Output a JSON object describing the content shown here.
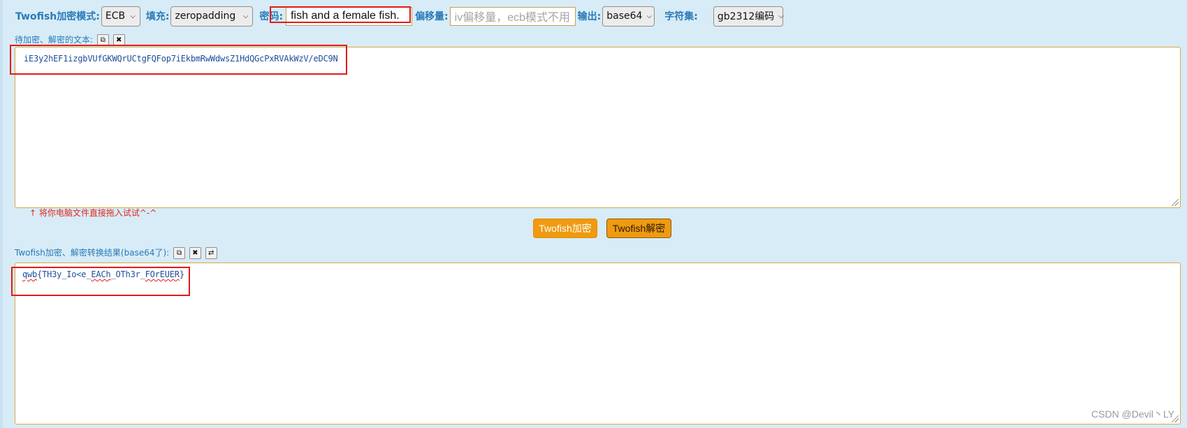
{
  "toolbar": {
    "mode_label": "Twofish加密模式:",
    "mode_value": "ECB",
    "padding_label": "填充:",
    "padding_value": "zeropadding",
    "password_label": "密码:",
    "password_value": "fish and a female fish.",
    "iv_label": "偏移量:",
    "iv_placeholder": "iv偏移量，ecb模式不用",
    "output_label": "输出:",
    "output_value": "base64",
    "charset_label": "字符集:",
    "charset_value": "gb2312编码"
  },
  "input_section": {
    "label": "待加密、解密的文本:",
    "copy_icon": "copy-icon",
    "clear_icon": "close-icon",
    "text": "iE3y2hEF1izgbVUfGKWQrUCtgFQFop7iEkbmRwWdwsZ1HdQGcPxRVAkWzV/eDC9N",
    "hint": "↑ 将你电脑文件直接拖入试试^-^"
  },
  "buttons": {
    "encrypt": "Twofish加密",
    "decrypt": "Twofish解密"
  },
  "result_section": {
    "label": "Twofish加密、解密转换结果(base64了):",
    "copy_icon": "copy-icon",
    "clear_icon": "close-icon",
    "swap_icon": "swap-icon",
    "text_parts": [
      "qwb",
      "{TH3y_Io<e_",
      "EACh",
      "_OTh3r_",
      "FOrEUER",
      "}"
    ]
  },
  "watermark": "CSDN @Devil丶LY",
  "colors": {
    "accent": "#ef9a10",
    "label_blue": "#2a7ab8",
    "highlight_red": "#e01b1b",
    "background": "#d7ecf7"
  }
}
